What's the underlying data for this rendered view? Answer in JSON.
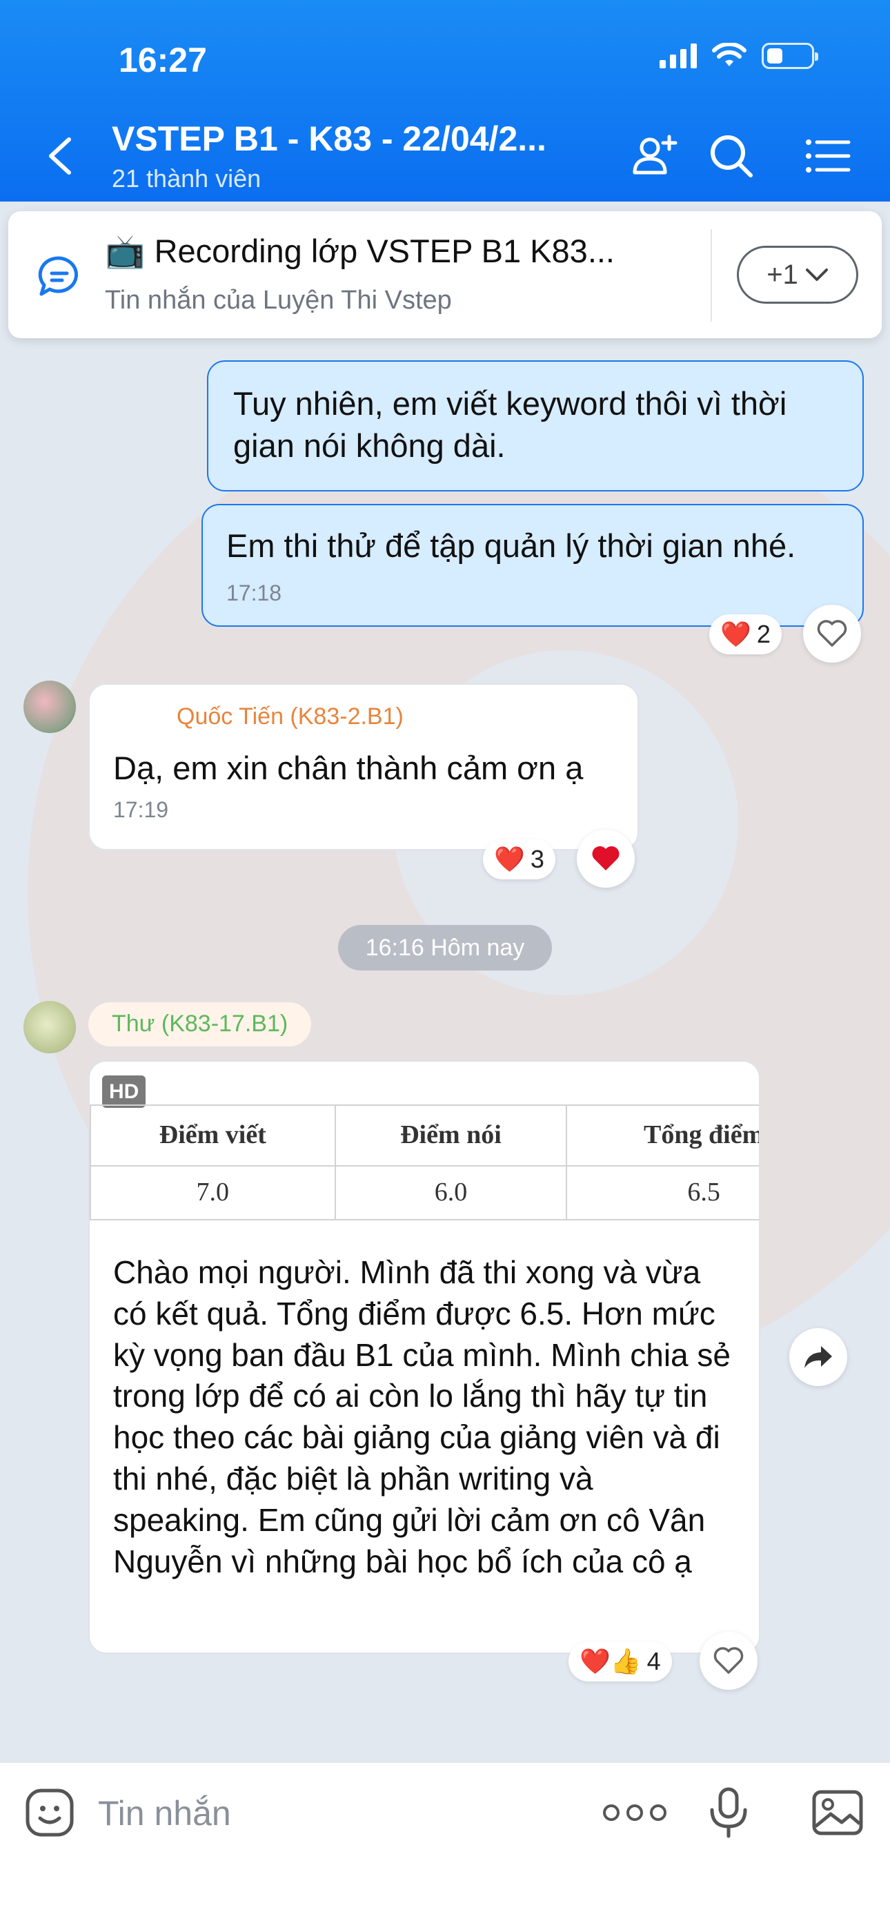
{
  "status": {
    "time": "16:27"
  },
  "header": {
    "title": "VSTEP B1 - K83 - 22/04/2...",
    "subtitle": "21 thành viên"
  },
  "pinned": {
    "title": "📺 Recording lớp VSTEP B1 K83...",
    "subtitle": "Tin nhắn của Luyện Thi Vstep",
    "more_label": "+1"
  },
  "messages": {
    "m1": {
      "text": "Tuy nhiên, em viết keyword thôi vì thời gian nói không dài."
    },
    "m2": {
      "text": "Em thi thử để tập quản lý thời gian nhé.",
      "time": "17:18",
      "reactions": "❤️",
      "reaction_count": "2"
    },
    "m3": {
      "sender": "Quốc Tiến (K83-2.B1)",
      "text": "Dạ, em xin chân thành cảm ơn ạ",
      "time": "17:19",
      "reactions": "❤️",
      "reaction_count": "3"
    },
    "date_separator": "16:16 Hôm nay",
    "m4": {
      "sender": "Thư (K83-17.B1)",
      "badge": "HD",
      "table": {
        "headers": [
          "Điểm viết",
          "Điểm nói",
          "Tổng điểm"
        ],
        "row": [
          "7.0",
          "6.0",
          "6.5"
        ]
      },
      "text": "Chào mọi người. Mình đã thi xong và vừa có kết quả. Tổng điểm được 6.5. Hơn mức kỳ vọng ban đầu B1 của mình. Mình chia sẻ trong lớp để có ai còn lo lắng thì hãy tự tin học theo các bài giảng của giảng viên và đi thi nhé, đặc biệt là phần writing và speaking. Em cũng gửi lời cảm ơn cô Vân Nguyễn vì những bài học bổ ích của cô ạ",
      "reactions": "❤️👍",
      "reaction_count": "4"
    }
  },
  "input": {
    "placeholder": "Tin nhắn"
  },
  "colors": {
    "header": "#0b6ef0",
    "outgoing_bubble": "#d6ecff",
    "sender_orange": "#e8843c",
    "sender_green": "#5cb85c"
  }
}
